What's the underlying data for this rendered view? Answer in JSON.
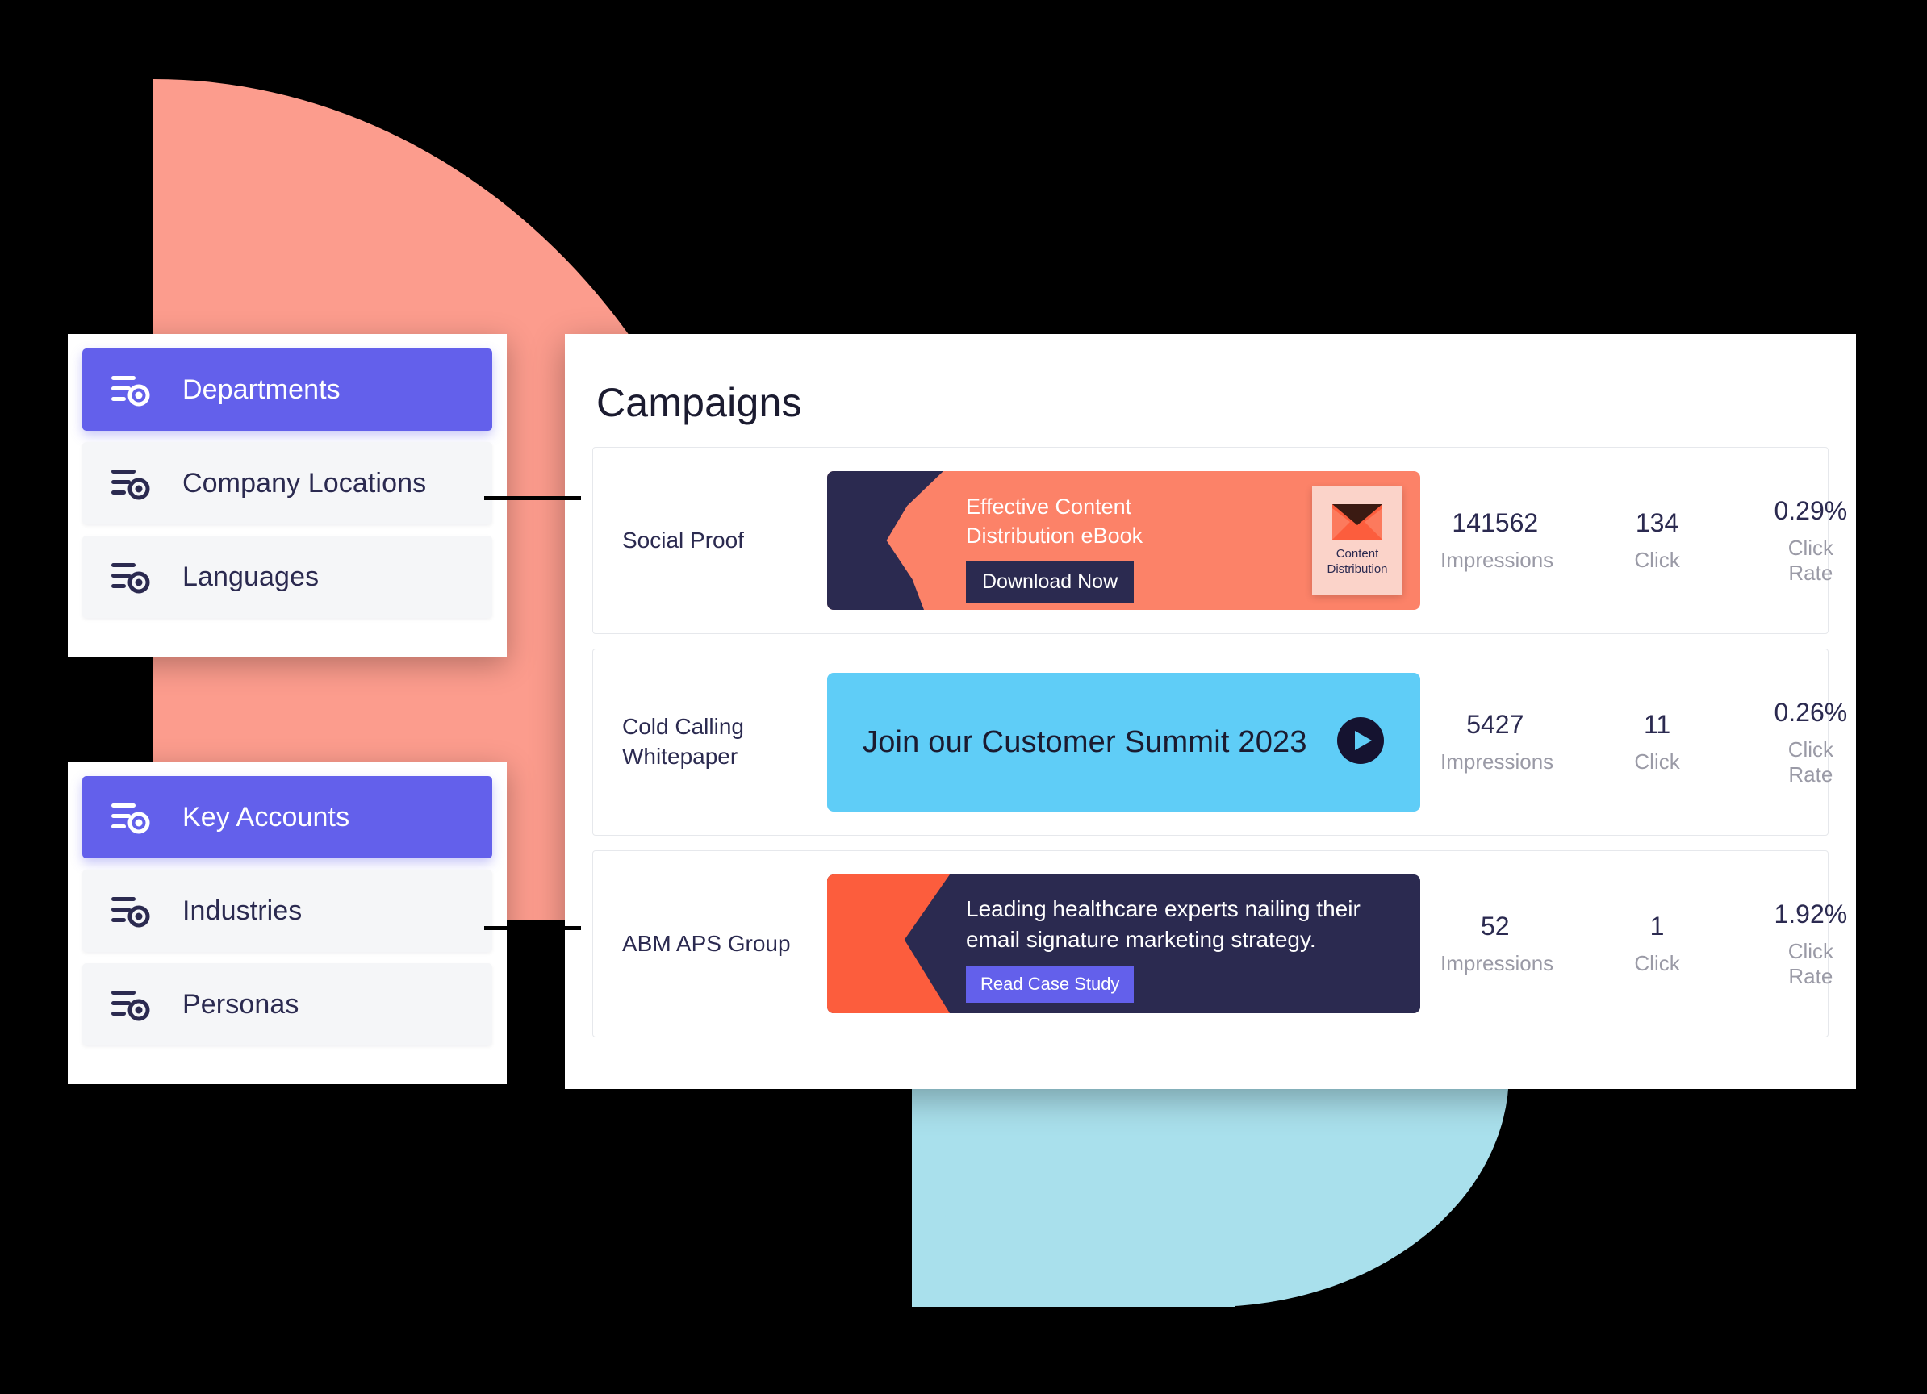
{
  "theme": {
    "background": "#000000",
    "accent_violet": "#6360EB",
    "accent_navy": "#2B2A50",
    "accent_salmon": "#FC8268",
    "accent_orange": "#FC5D3D",
    "accent_sky": "#5FCDF7",
    "deco_salmon": "#FC9C8D",
    "deco_blue": "#A9E0EC",
    "muted_text": "#9A9AA6",
    "panel_bg": "#FFFFFF",
    "item_bg": "#F5F6F8"
  },
  "sidebar_top": {
    "items": [
      {
        "label": "Departments",
        "icon": "filter-lines-circle-icon",
        "active": true
      },
      {
        "label": "Company Locations",
        "icon": "filter-lines-circle-icon",
        "active": false
      },
      {
        "label": "Languages",
        "icon": "filter-lines-circle-icon",
        "active": false
      }
    ]
  },
  "sidebar_bottom": {
    "items": [
      {
        "label": "Key Accounts",
        "icon": "filter-lines-circle-icon",
        "active": true
      },
      {
        "label": "Industries",
        "icon": "filter-lines-circle-icon",
        "active": false
      },
      {
        "label": "Personas",
        "icon": "filter-lines-circle-icon",
        "active": false
      }
    ]
  },
  "main": {
    "title": "Campaigns",
    "metric_labels": {
      "impressions": "Impressions",
      "click": "Click",
      "click_rate": "Click Rate"
    },
    "campaigns": [
      {
        "name": "Social Proof",
        "banner": {
          "style": "salmon-wedge",
          "headline_line1": "Effective Content",
          "headline_line2": "Distribution eBook",
          "cta": "Download Now",
          "thumbnail_icon": "envelope-icon",
          "thumbnail_caption_line1": "Content",
          "thumbnail_caption_line2": "Distribution"
        },
        "impressions": "141562",
        "clicks": "134",
        "click_rate": "0.29%"
      },
      {
        "name_line1": "Cold Calling",
        "name_line2": "Whitepaper",
        "banner": {
          "style": "sky-play",
          "headline": "Join our Customer Summit 2023",
          "icon": "play-icon"
        },
        "impressions": "5427",
        "clicks": "11",
        "click_rate": "0.26%"
      },
      {
        "name": "ABM APS Group",
        "banner": {
          "style": "navy-wedge",
          "headline_line1": "Leading healthcare experts nailing their",
          "headline_line2": "email signature marketing strategy.",
          "cta": "Read Case Study"
        },
        "impressions": "52",
        "clicks": "1",
        "click_rate": "1.92%"
      }
    ]
  }
}
